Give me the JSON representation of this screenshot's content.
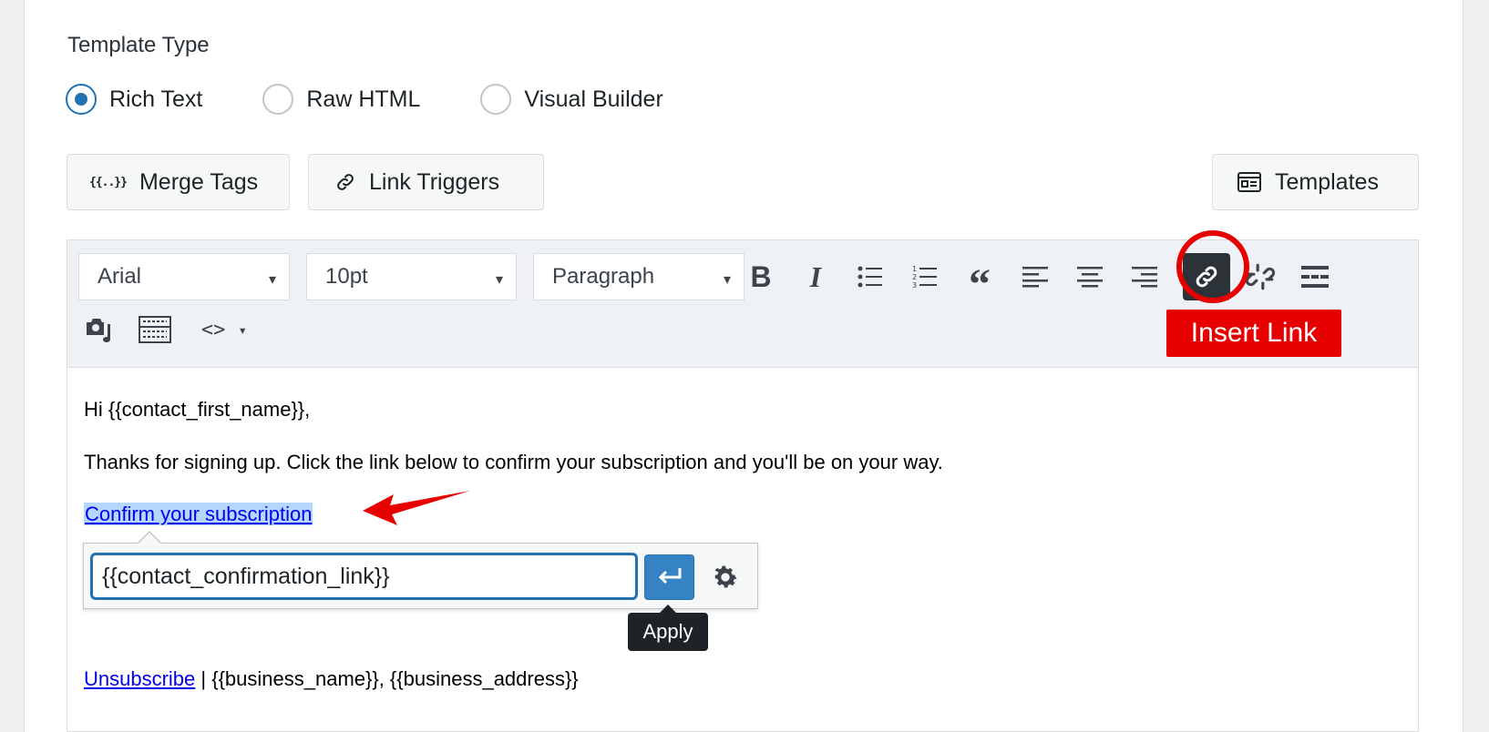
{
  "template_type": {
    "label": "Template Type",
    "options": [
      {
        "label": "Rich Text",
        "checked": true
      },
      {
        "label": "Raw HTML",
        "checked": false
      },
      {
        "label": "Visual Builder",
        "checked": false
      }
    ]
  },
  "actions": {
    "merge_tags_icon": "{{..}}",
    "merge_tags_label": "Merge Tags",
    "link_triggers_label": "Link Triggers",
    "templates_label": "Templates"
  },
  "toolbar": {
    "font_family": "Arial",
    "font_size": "10pt",
    "block_format": "Paragraph",
    "buttons": [
      "bold-icon",
      "italic-icon",
      "bullet-list-icon",
      "numbered-list-icon",
      "blockquote-icon",
      "align-left-icon",
      "align-center-icon",
      "align-right-icon",
      "insert-link-icon",
      "unlink-icon",
      "horizontal-rule-icon",
      "media-icon",
      "keyboard-shortcuts-icon",
      "code-icon"
    ],
    "bold_glyph": "B",
    "italic_glyph": "I",
    "quote_glyph": "“",
    "code_glyph": "<>",
    "dropdown_caret": "▾"
  },
  "annotations": {
    "insert_link_label": "Insert Link",
    "highlight_color": "#e60000"
  },
  "content": {
    "greeting": "Hi {{contact_first_name}},",
    "body": "Thanks for signing up. Click the link below to confirm your subscription and you'll be on your way.",
    "confirm_link_text": "Confirm your subscription",
    "unsubscribe_text": "Unsubscribe",
    "footer_rest": " | {{business_name}}, {{business_address}}"
  },
  "link_popup": {
    "url_value": "{{contact_confirmation_link}}",
    "apply_tooltip": "Apply"
  },
  "colors": {
    "accent": "#2271b1",
    "link": "#0000ee",
    "selection": "#b4d7ff"
  }
}
